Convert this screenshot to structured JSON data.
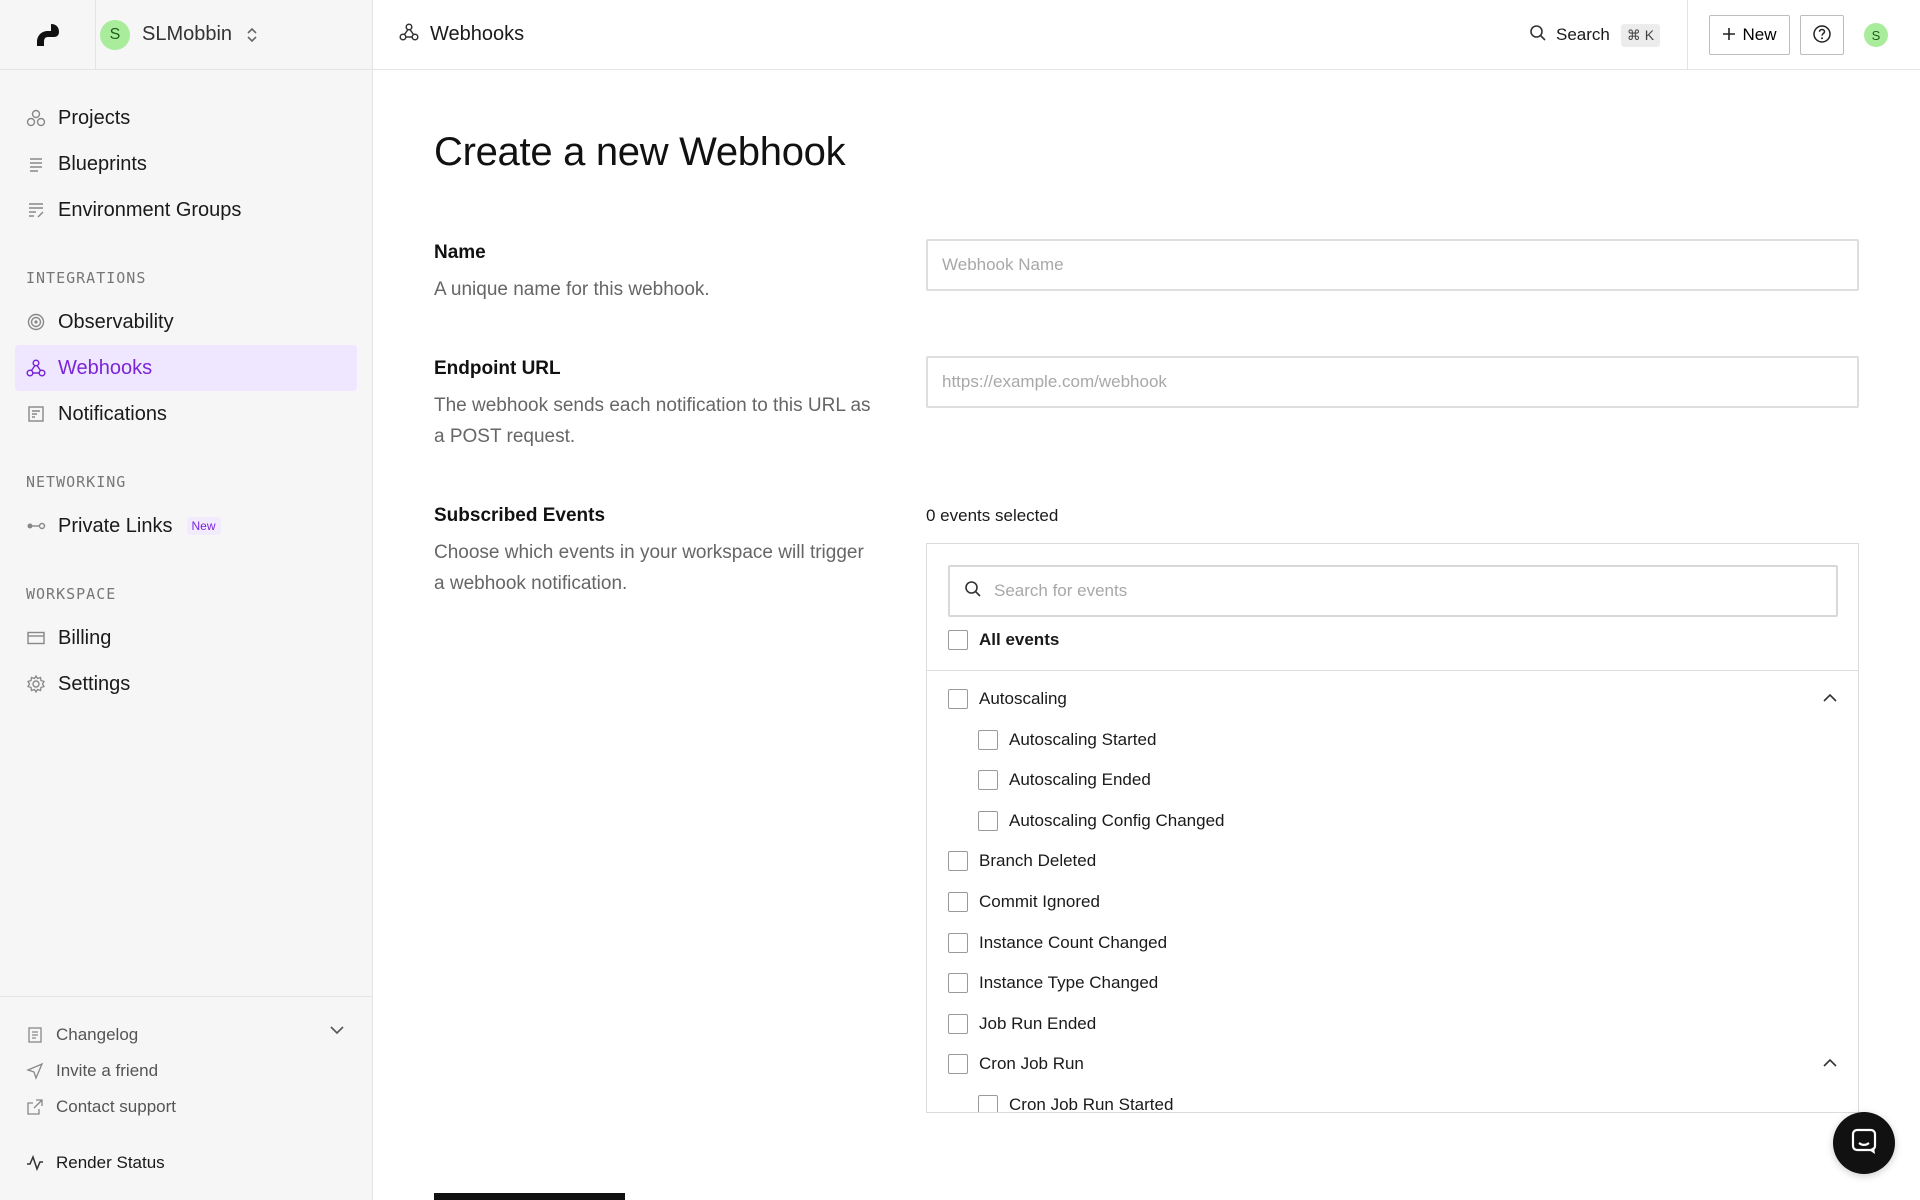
{
  "workspace": {
    "avatar_letter": "S",
    "name": "SLMobbin"
  },
  "sidebar": {
    "main_items": [
      {
        "label": "Projects"
      },
      {
        "label": "Blueprints"
      },
      {
        "label": "Environment Groups"
      }
    ],
    "integrations_label": "INTEGRATIONS",
    "integrations_items": [
      {
        "label": "Observability"
      },
      {
        "label": "Webhooks"
      },
      {
        "label": "Notifications"
      }
    ],
    "networking_label": "NETWORKING",
    "networking_items": [
      {
        "label": "Private Links",
        "badge": "New"
      }
    ],
    "workspace_label": "WORKSPACE",
    "workspace_items": [
      {
        "label": "Billing"
      },
      {
        "label": "Settings"
      }
    ],
    "footer": {
      "changelog": "Changelog",
      "invite": "Invite a friend",
      "support": "Contact support",
      "status": "Render Status"
    }
  },
  "topbar": {
    "breadcrumb": "Webhooks",
    "search_label": "Search",
    "search_shortcut": "⌘ K",
    "new_label": "New",
    "user_letter": "S"
  },
  "form": {
    "title": "Create a new Webhook",
    "name_label": "Name",
    "name_desc": "A unique name for this webhook.",
    "name_placeholder": "Webhook Name",
    "url_label": "Endpoint URL",
    "url_desc": "The webhook sends each notification to this URL as a POST request.",
    "url_placeholder": "https://example.com/webhook",
    "events_label": "Subscribed Events",
    "events_desc": "Choose which events in your workspace will trigger a webhook notification.",
    "events_count": "0 events selected",
    "events_search_placeholder": "Search for events",
    "all_events": "All events",
    "events": [
      {
        "label": "Autoscaling",
        "level": 0,
        "expandable": true
      },
      {
        "label": "Autoscaling Started",
        "level": 1
      },
      {
        "label": "Autoscaling Ended",
        "level": 1
      },
      {
        "label": "Autoscaling Config Changed",
        "level": 1
      },
      {
        "label": "Branch Deleted",
        "level": 0
      },
      {
        "label": "Commit Ignored",
        "level": 0
      },
      {
        "label": "Instance Count Changed",
        "level": 0
      },
      {
        "label": "Instance Type Changed",
        "level": 0
      },
      {
        "label": "Job Run Ended",
        "level": 0
      },
      {
        "label": "Cron Job Run",
        "level": 0,
        "expandable": true
      },
      {
        "label": "Cron Job Run Started",
        "level": 1
      }
    ]
  },
  "colors": {
    "accent": "#7a26d8",
    "active_bg": "#efe7ff",
    "avatar_bg": "#a8ec9c"
  }
}
